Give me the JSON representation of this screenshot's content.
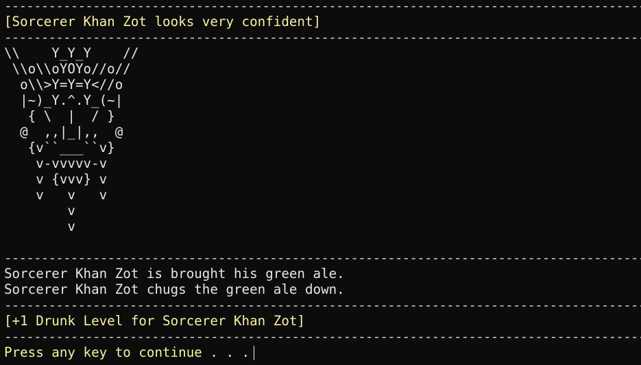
{
  "colors": {
    "background": "#0c0c0c",
    "text": "#cccccc",
    "highlight_yellow": "#f9f1a5"
  },
  "separator": "----------------------------------------------------------------------------------------------------",
  "status_header": "[Sorcerer Khan Zot looks very confident]",
  "ascii_art": [
    "\\\\    Y_Y_Y    //",
    " \\\\o\\\\oYOYo//o//",
    "  o\\\\>Y=Y=Y<//o",
    "  |~)_Y.^.Y_(~|",
    "   { \\  |  / }",
    "  @  ,,|_|,,  @",
    "   {v``___``v}",
    "    v-vvvvv-v",
    "    v {vvv} v",
    "    v   v   v",
    "        v",
    "        v"
  ],
  "narration": [
    "Sorcerer Khan Zot is brought his green ale.",
    "Sorcerer Khan Zot chugs the green ale down."
  ],
  "effect": "[+1 Drunk Level for Sorcerer Khan Zot]",
  "prompt": "Press any key to continue . . ."
}
